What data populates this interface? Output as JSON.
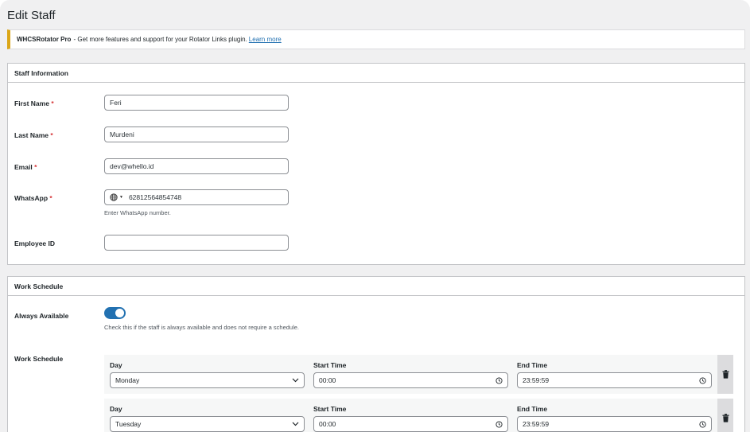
{
  "page": {
    "title": "Edit Staff"
  },
  "notice": {
    "brand": "WHCSRotator Pro",
    "text": "- Get more features and support for your Rotator Links plugin.",
    "link": "Learn more"
  },
  "staff_info": {
    "heading": "Staff Information",
    "first_name": {
      "label": "First Name",
      "required": "*",
      "value": "Feri"
    },
    "last_name": {
      "label": "Last Name",
      "required": "*",
      "value": "Murdeni"
    },
    "email": {
      "label": "Email",
      "required": "*",
      "value": "dev@whello.id"
    },
    "whatsapp": {
      "label": "WhatsApp",
      "required": "*",
      "value": "62812564854748",
      "hint": "Enter WhatsApp number."
    },
    "employee_id": {
      "label": "Employee ID",
      "value": ""
    }
  },
  "work_schedule": {
    "heading": "Work Schedule",
    "always_available": {
      "label": "Always Available",
      "checked": true,
      "hint": "Check this if the staff is always available and does not require a schedule."
    },
    "schedule_label": "Work Schedule",
    "col_day": "Day",
    "col_start": "Start Time",
    "col_end": "End Time",
    "rows": [
      {
        "day": "Monday",
        "start": "00:00",
        "end": "23:59:59"
      },
      {
        "day": "Tuesday",
        "start": "00:00",
        "end": "23:59:59"
      }
    ]
  },
  "colors": {
    "accent": "#2271b1",
    "notice_border": "#dba617",
    "required": "#d63638"
  },
  "icons": [
    "globe-icon",
    "chevron-down-icon",
    "clock-icon",
    "trash-icon"
  ]
}
